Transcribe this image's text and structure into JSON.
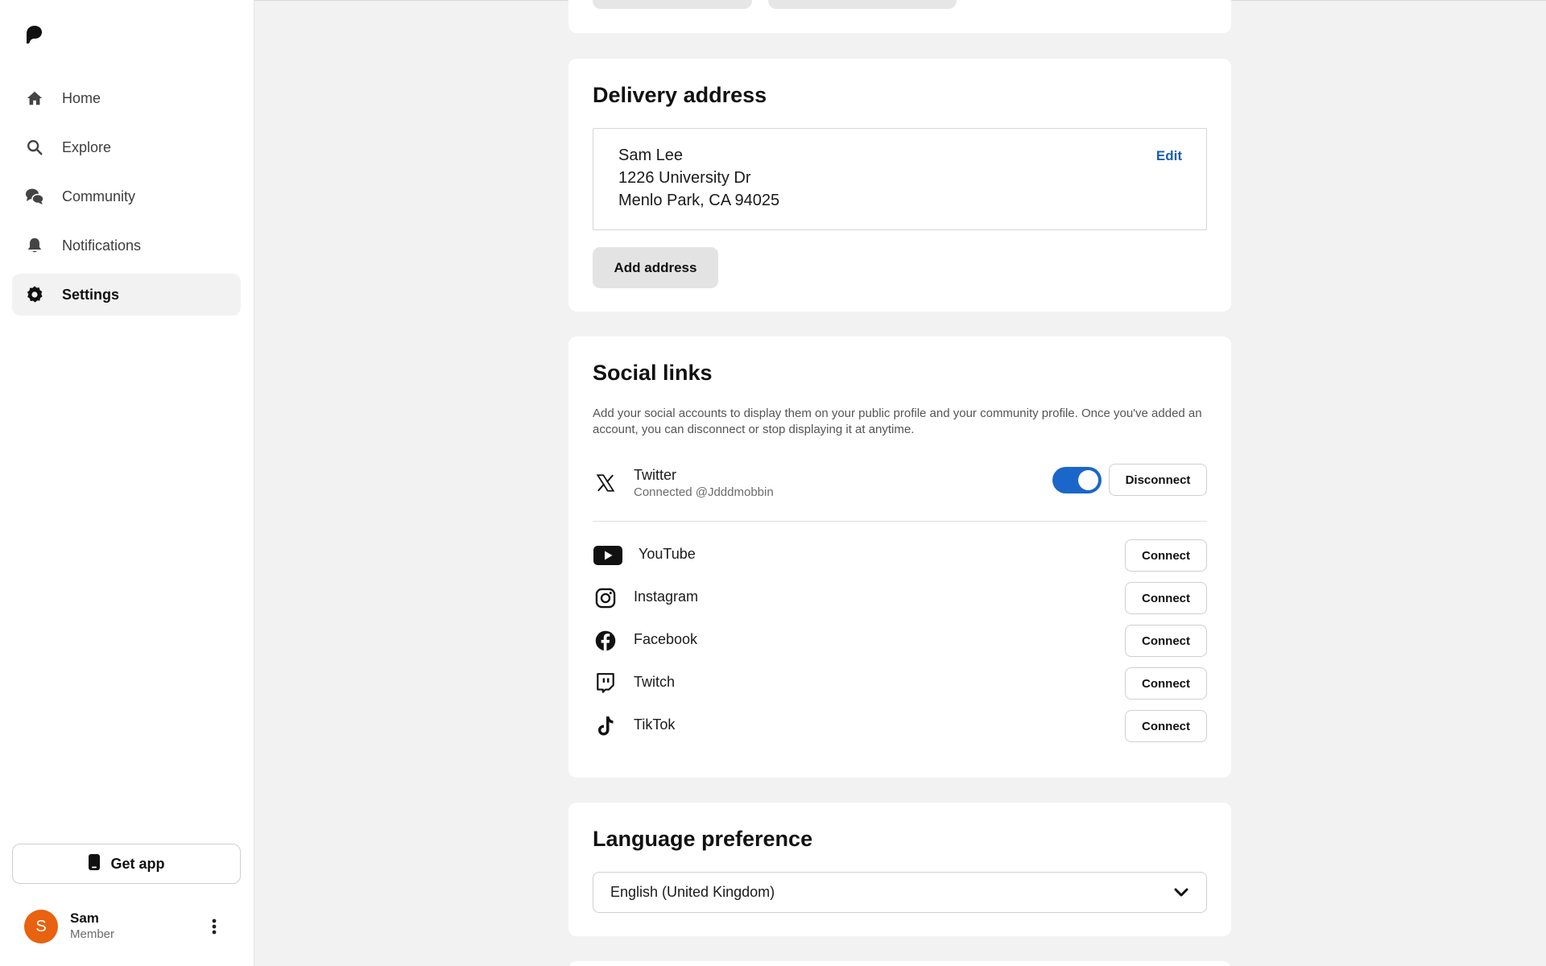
{
  "sidebar": {
    "logo": "patreon-logo",
    "items": [
      {
        "label": "Home",
        "icon": "home-icon"
      },
      {
        "label": "Explore",
        "icon": "search-icon"
      },
      {
        "label": "Community",
        "icon": "chat-bubbles-icon"
      },
      {
        "label": "Notifications",
        "icon": "bell-icon"
      },
      {
        "label": "Settings",
        "icon": "gear-icon",
        "active": true
      }
    ],
    "get_app": "Get app",
    "user": {
      "initial": "S",
      "name": "Sam",
      "role": "Member",
      "avatar_color": "#e8620f"
    }
  },
  "delivery": {
    "title": "Delivery address",
    "address_lines": [
      "Sam Lee",
      "1226 University Dr",
      "Menlo Park, CA 94025"
    ],
    "edit_label": "Edit",
    "add_label": "Add address"
  },
  "social": {
    "title": "Social links",
    "description": "Add your social accounts to display them on your public profile and your community profile. Once you've added an account, you can disconnect or stop displaying it at anytime.",
    "twitter": {
      "name": "Twitter",
      "status": "Connected @Jdddmobbin",
      "toggle_on": true,
      "button": "Disconnect"
    },
    "accounts": [
      {
        "name": "YouTube",
        "icon": "youtube-icon",
        "button": "Connect"
      },
      {
        "name": "Instagram",
        "icon": "instagram-icon",
        "button": "Connect"
      },
      {
        "name": "Facebook",
        "icon": "facebook-icon",
        "button": "Connect"
      },
      {
        "name": "Twitch",
        "icon": "twitch-icon",
        "button": "Connect"
      },
      {
        "name": "TikTok",
        "icon": "tiktok-icon",
        "button": "Connect"
      }
    ]
  },
  "language": {
    "title": "Language preference",
    "selected": "English (United Kingdom)"
  },
  "colors": {
    "accent": "#1b66c9",
    "link": "#1a5fb4",
    "avatar": "#e8620f"
  }
}
